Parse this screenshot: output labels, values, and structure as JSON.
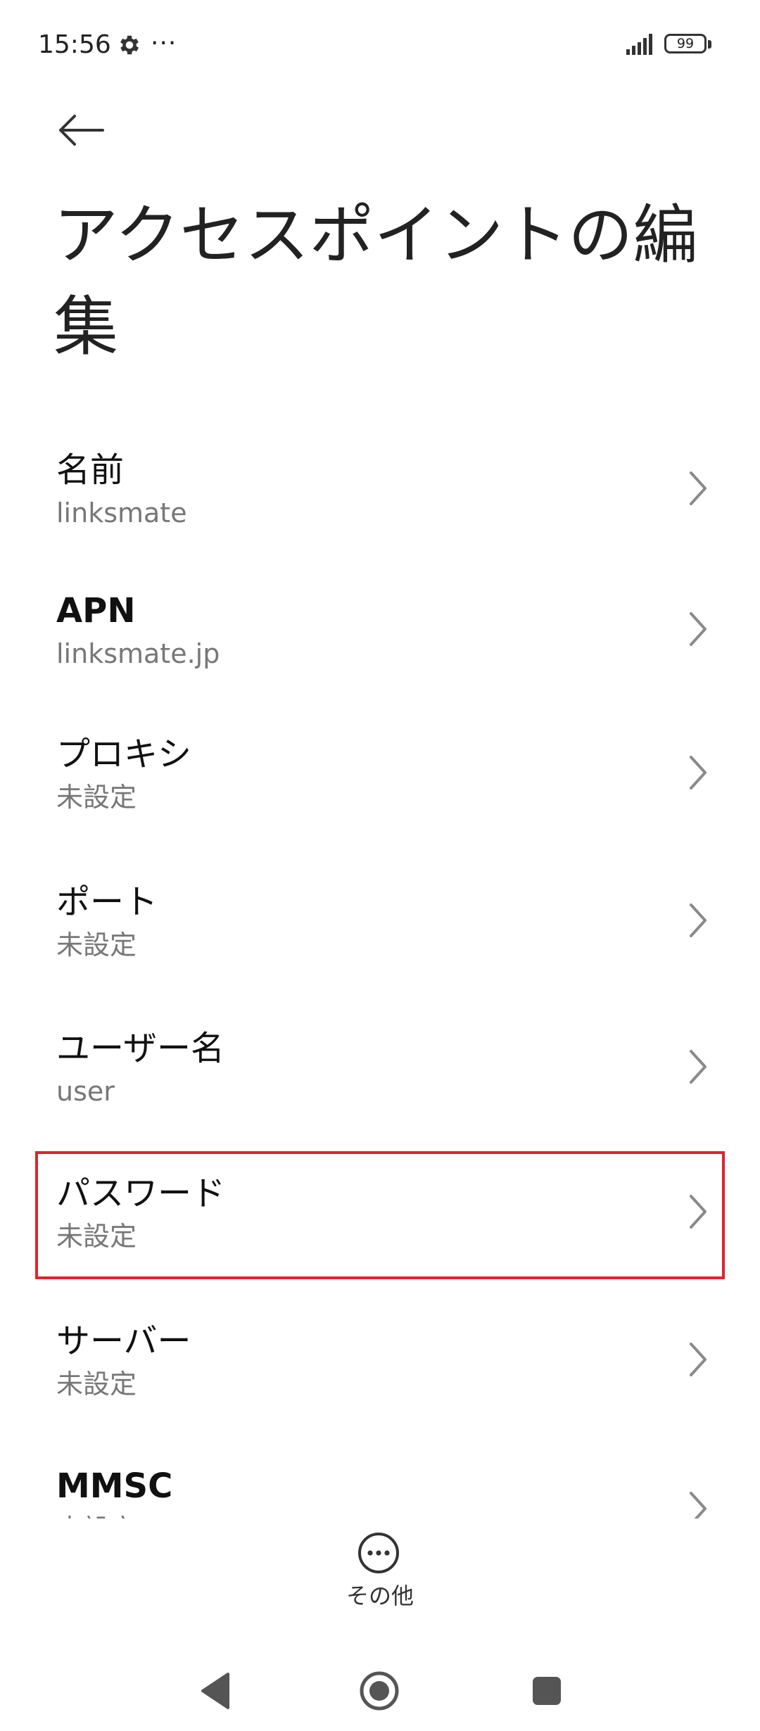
{
  "status_bar": {
    "time": "15:56",
    "more": "···",
    "battery": "99",
    "icons": [
      "gear-icon",
      "signal-icon",
      "battery-icon"
    ]
  },
  "header": {
    "back_icon": "arrow-left-icon",
    "title": "アクセスポイントの編集"
  },
  "settings": {
    "items": [
      {
        "label": "名前",
        "value": "linksmate"
      },
      {
        "label": "APN",
        "value": "linksmate.jp"
      },
      {
        "label": "プロキシ",
        "value": "未設定"
      },
      {
        "label": "ポート",
        "value": "未設定"
      },
      {
        "label": "ユーザー名",
        "value": "user"
      },
      {
        "label": "パスワード",
        "value": "未設定",
        "highlighted": true
      },
      {
        "label": "サーバー",
        "value": "未設定"
      },
      {
        "label": "MMSC",
        "value": "未設定"
      }
    ],
    "chevron_icon": "chevron-right-icon",
    "highlight_color": "#e02333"
  },
  "more": {
    "label": "その他",
    "icon": "more-circle-icon"
  },
  "nav_bar": {
    "icons": [
      "nav-back-icon",
      "nav-home-icon",
      "nav-recents-icon"
    ]
  }
}
